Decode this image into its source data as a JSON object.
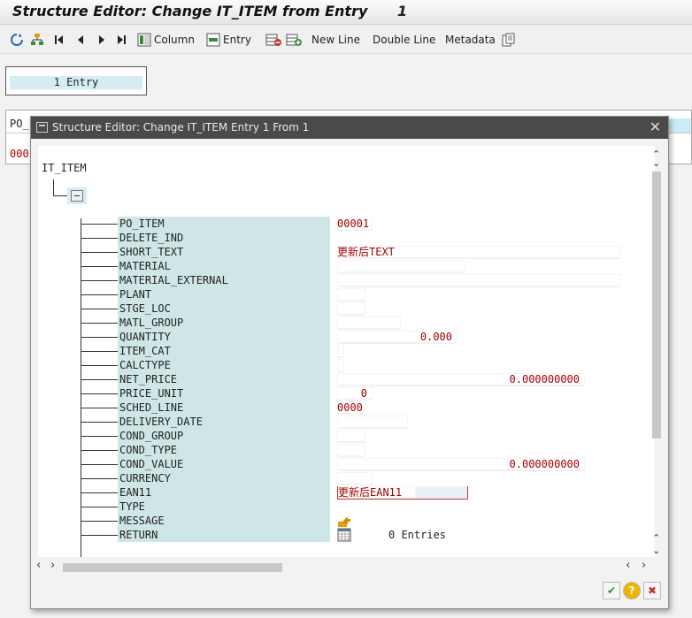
{
  "window": {
    "title": "Structure Editor: Change IT_ITEM from Entry",
    "entry_number": "1"
  },
  "toolbar": {
    "column_label": "Column",
    "entry_label": "Entry",
    "new_line_label": "New Line",
    "double_line_label": "Double Line",
    "metadata_label": "Metadata",
    "icons": [
      "refresh-icon",
      "hierarchy-icon",
      "first-icon",
      "previous-icon",
      "next-icon",
      "last-icon",
      "column-icon",
      "entry-icon",
      "delete-row-icon",
      "add-row-icon",
      "copy-icon"
    ]
  },
  "background": {
    "entry_field": "1 Entry",
    "table_header": "PO_",
    "table_value": "000"
  },
  "dialog": {
    "title": "Structure Editor: Change IT_ITEM Entry 1 From 1",
    "root": "IT_ITEM",
    "fields": [
      {
        "name": "PO_ITEM",
        "value": ""
      },
      {
        "name": "DELETE_IND",
        "value": ""
      },
      {
        "name": "SHORT_TEXT",
        "value": "更新后TEXT"
      },
      {
        "name": "MATERIAL",
        "value": ""
      },
      {
        "name": "MATERIAL_EXTERNAL",
        "value": ""
      },
      {
        "name": "PLANT",
        "value": ""
      },
      {
        "name": "STGE_LOC",
        "value": ""
      },
      {
        "name": "MATL_GROUP",
        "value": ""
      },
      {
        "name": "QUANTITY",
        "value": "0.000"
      },
      {
        "name": "ITEM_CAT",
        "value": ""
      },
      {
        "name": "CALCTYPE",
        "value": ""
      },
      {
        "name": "NET_PRICE",
        "value": "0.000000000"
      },
      {
        "name": "PRICE_UNIT",
        "value": "0"
      },
      {
        "name": "SCHED_LINE",
        "value": "0000"
      },
      {
        "name": "DELIVERY_DATE",
        "value": ""
      },
      {
        "name": "COND_GROUP",
        "value": ""
      },
      {
        "name": "COND_TYPE",
        "value": ""
      },
      {
        "name": "COND_VALUE",
        "value": "0.000000000"
      },
      {
        "name": "CURRENCY",
        "value": ""
      },
      {
        "name": "EAN11",
        "value": "更新后EAN11"
      },
      {
        "name": "TYPE",
        "value": ""
      },
      {
        "name": "MESSAGE",
        "value": ""
      },
      {
        "name": "RETURN",
        "value": "0 Entries"
      }
    ],
    "po_item_value": "00001",
    "buttons": [
      "confirm-icon",
      "help-icon",
      "cancel-icon"
    ],
    "colors": {
      "title_bar": "#4a4a4a",
      "field_bg": "#cfe6e6",
      "value_text": "#a00000"
    }
  }
}
